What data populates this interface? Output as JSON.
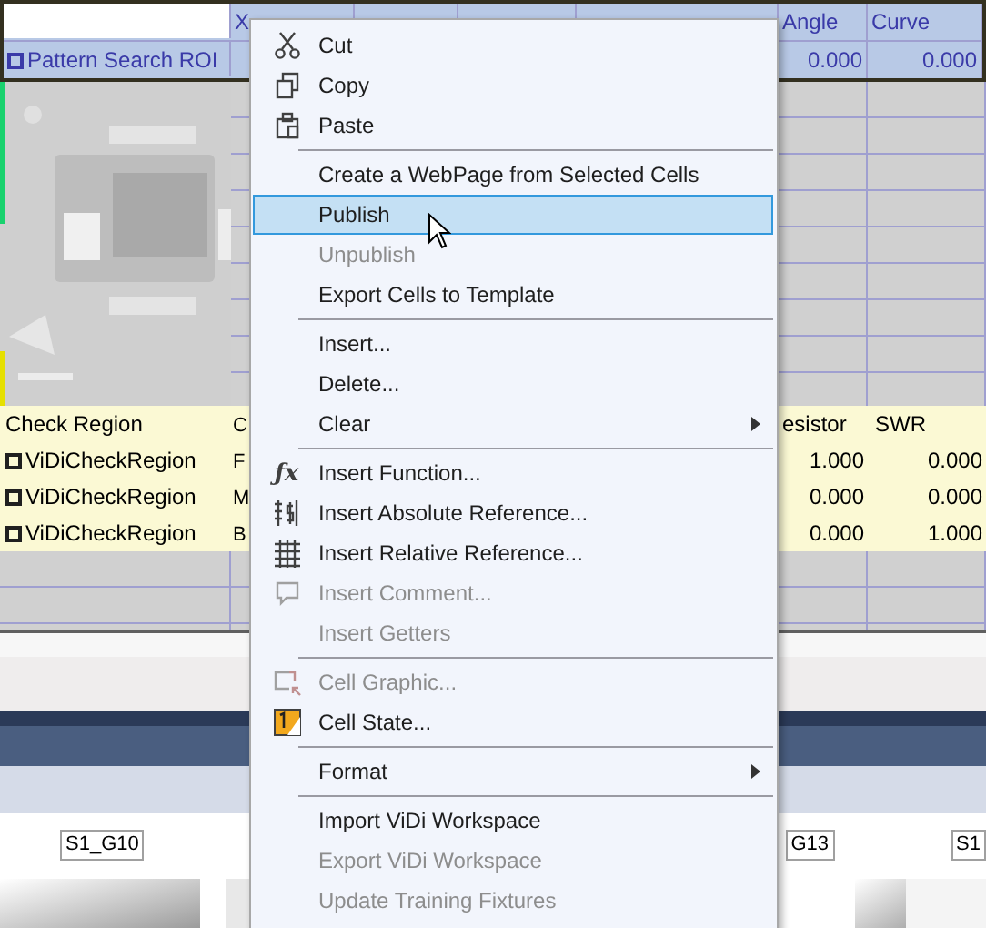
{
  "sheet": {
    "header": {
      "x": "X",
      "angle": "Angle",
      "curve": "Curve"
    },
    "roi_row": {
      "name": "Pattern Search ROI",
      "angle": "0.000",
      "curve": "0.000"
    },
    "check_table": {
      "header": {
        "name": "Check Region",
        "column_2": "C",
        "column_6": "esistor",
        "column_7": "SWR"
      },
      "rows": [
        {
          "name": "ViDiCheckRegion",
          "column_2": "F",
          "column_6": "1.000",
          "column_7": "0.000"
        },
        {
          "name": "ViDiCheckRegion",
          "column_2": "M",
          "column_6": "0.000",
          "column_7": "0.000"
        },
        {
          "name": "ViDiCheckRegion",
          "column_2": "B",
          "column_6": "0.000",
          "column_7": "1.000"
        }
      ]
    }
  },
  "image_strip": {
    "labels": [
      "S1_G10",
      "G13",
      "S1"
    ]
  },
  "context_menu": {
    "items": [
      {
        "kind": "item",
        "label": "Cut",
        "disabled": false,
        "selected": false,
        "submenu": false
      },
      {
        "kind": "item",
        "label": "Copy",
        "disabled": false,
        "selected": false,
        "submenu": false
      },
      {
        "kind": "item",
        "label": "Paste",
        "disabled": false,
        "selected": false,
        "submenu": false
      },
      {
        "kind": "separator"
      },
      {
        "kind": "item",
        "label": "Create a WebPage from Selected Cells",
        "disabled": false,
        "selected": false,
        "submenu": false
      },
      {
        "kind": "item",
        "label": "Publish",
        "disabled": false,
        "selected": true,
        "submenu": false
      },
      {
        "kind": "item",
        "label": "Unpublish",
        "disabled": true,
        "selected": false,
        "submenu": false
      },
      {
        "kind": "item",
        "label": "Export Cells to Template",
        "disabled": false,
        "selected": false,
        "submenu": false
      },
      {
        "kind": "separator"
      },
      {
        "kind": "item",
        "label": "Insert...",
        "disabled": false,
        "selected": false,
        "submenu": false
      },
      {
        "kind": "item",
        "label": "Delete...",
        "disabled": false,
        "selected": false,
        "submenu": false
      },
      {
        "kind": "item",
        "label": "Clear",
        "disabled": false,
        "selected": false,
        "submenu": true
      },
      {
        "kind": "separator"
      },
      {
        "kind": "item",
        "label": "Insert Function...",
        "disabled": false,
        "selected": false,
        "submenu": false,
        "icon_text": "ƒx"
      },
      {
        "kind": "item",
        "label": "Insert Absolute Reference...",
        "disabled": false,
        "selected": false,
        "submenu": false
      },
      {
        "kind": "item",
        "label": "Insert Relative Reference...",
        "disabled": false,
        "selected": false,
        "submenu": false
      },
      {
        "kind": "item",
        "label": "Insert Comment...",
        "disabled": true,
        "selected": false,
        "submenu": false
      },
      {
        "kind": "item",
        "label": "Insert Getters",
        "disabled": true,
        "selected": false,
        "submenu": false
      },
      {
        "kind": "separator"
      },
      {
        "kind": "item",
        "label": "Cell Graphic...",
        "disabled": true,
        "selected": false,
        "submenu": false
      },
      {
        "kind": "item",
        "label": "Cell State...",
        "disabled": false,
        "selected": false,
        "submenu": false
      },
      {
        "kind": "separator"
      },
      {
        "kind": "item",
        "label": "Format",
        "disabled": false,
        "selected": false,
        "submenu": true
      },
      {
        "kind": "separator"
      },
      {
        "kind": "item",
        "label": "Import ViDi Workspace",
        "disabled": false,
        "selected": false,
        "submenu": false
      },
      {
        "kind": "item",
        "label": "Export ViDi Workspace",
        "disabled": true,
        "selected": false,
        "submenu": false
      },
      {
        "kind": "item",
        "label": "Update Training Fixtures",
        "disabled": true,
        "selected": false,
        "submenu": false
      }
    ]
  }
}
